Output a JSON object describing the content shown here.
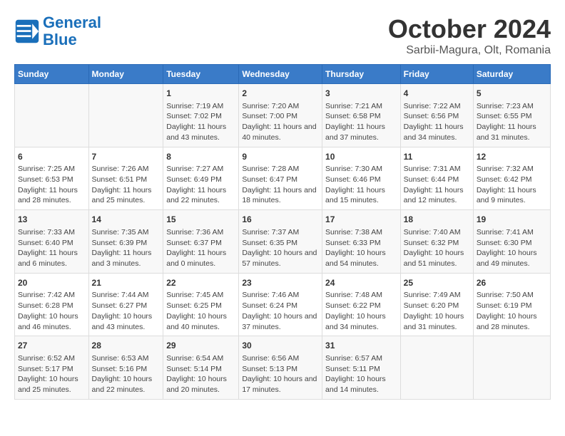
{
  "header": {
    "logo_line1": "General",
    "logo_line2": "Blue",
    "month": "October 2024",
    "location": "Sarbii-Magura, Olt, Romania"
  },
  "days_of_week": [
    "Sunday",
    "Monday",
    "Tuesday",
    "Wednesday",
    "Thursday",
    "Friday",
    "Saturday"
  ],
  "weeks": [
    [
      {
        "day": "",
        "content": ""
      },
      {
        "day": "",
        "content": ""
      },
      {
        "day": "1",
        "content": "Sunrise: 7:19 AM\nSunset: 7:02 PM\nDaylight: 11 hours and 43 minutes."
      },
      {
        "day": "2",
        "content": "Sunrise: 7:20 AM\nSunset: 7:00 PM\nDaylight: 11 hours and 40 minutes."
      },
      {
        "day": "3",
        "content": "Sunrise: 7:21 AM\nSunset: 6:58 PM\nDaylight: 11 hours and 37 minutes."
      },
      {
        "day": "4",
        "content": "Sunrise: 7:22 AM\nSunset: 6:56 PM\nDaylight: 11 hours and 34 minutes."
      },
      {
        "day": "5",
        "content": "Sunrise: 7:23 AM\nSunset: 6:55 PM\nDaylight: 11 hours and 31 minutes."
      }
    ],
    [
      {
        "day": "6",
        "content": "Sunrise: 7:25 AM\nSunset: 6:53 PM\nDaylight: 11 hours and 28 minutes."
      },
      {
        "day": "7",
        "content": "Sunrise: 7:26 AM\nSunset: 6:51 PM\nDaylight: 11 hours and 25 minutes."
      },
      {
        "day": "8",
        "content": "Sunrise: 7:27 AM\nSunset: 6:49 PM\nDaylight: 11 hours and 22 minutes."
      },
      {
        "day": "9",
        "content": "Sunrise: 7:28 AM\nSunset: 6:47 PM\nDaylight: 11 hours and 18 minutes."
      },
      {
        "day": "10",
        "content": "Sunrise: 7:30 AM\nSunset: 6:46 PM\nDaylight: 11 hours and 15 minutes."
      },
      {
        "day": "11",
        "content": "Sunrise: 7:31 AM\nSunset: 6:44 PM\nDaylight: 11 hours and 12 minutes."
      },
      {
        "day": "12",
        "content": "Sunrise: 7:32 AM\nSunset: 6:42 PM\nDaylight: 11 hours and 9 minutes."
      }
    ],
    [
      {
        "day": "13",
        "content": "Sunrise: 7:33 AM\nSunset: 6:40 PM\nDaylight: 11 hours and 6 minutes."
      },
      {
        "day": "14",
        "content": "Sunrise: 7:35 AM\nSunset: 6:39 PM\nDaylight: 11 hours and 3 minutes."
      },
      {
        "day": "15",
        "content": "Sunrise: 7:36 AM\nSunset: 6:37 PM\nDaylight: 11 hours and 0 minutes."
      },
      {
        "day": "16",
        "content": "Sunrise: 7:37 AM\nSunset: 6:35 PM\nDaylight: 10 hours and 57 minutes."
      },
      {
        "day": "17",
        "content": "Sunrise: 7:38 AM\nSunset: 6:33 PM\nDaylight: 10 hours and 54 minutes."
      },
      {
        "day": "18",
        "content": "Sunrise: 7:40 AM\nSunset: 6:32 PM\nDaylight: 10 hours and 51 minutes."
      },
      {
        "day": "19",
        "content": "Sunrise: 7:41 AM\nSunset: 6:30 PM\nDaylight: 10 hours and 49 minutes."
      }
    ],
    [
      {
        "day": "20",
        "content": "Sunrise: 7:42 AM\nSunset: 6:28 PM\nDaylight: 10 hours and 46 minutes."
      },
      {
        "day": "21",
        "content": "Sunrise: 7:44 AM\nSunset: 6:27 PM\nDaylight: 10 hours and 43 minutes."
      },
      {
        "day": "22",
        "content": "Sunrise: 7:45 AM\nSunset: 6:25 PM\nDaylight: 10 hours and 40 minutes."
      },
      {
        "day": "23",
        "content": "Sunrise: 7:46 AM\nSunset: 6:24 PM\nDaylight: 10 hours and 37 minutes."
      },
      {
        "day": "24",
        "content": "Sunrise: 7:48 AM\nSunset: 6:22 PM\nDaylight: 10 hours and 34 minutes."
      },
      {
        "day": "25",
        "content": "Sunrise: 7:49 AM\nSunset: 6:20 PM\nDaylight: 10 hours and 31 minutes."
      },
      {
        "day": "26",
        "content": "Sunrise: 7:50 AM\nSunset: 6:19 PM\nDaylight: 10 hours and 28 minutes."
      }
    ],
    [
      {
        "day": "27",
        "content": "Sunrise: 6:52 AM\nSunset: 5:17 PM\nDaylight: 10 hours and 25 minutes."
      },
      {
        "day": "28",
        "content": "Sunrise: 6:53 AM\nSunset: 5:16 PM\nDaylight: 10 hours and 22 minutes."
      },
      {
        "day": "29",
        "content": "Sunrise: 6:54 AM\nSunset: 5:14 PM\nDaylight: 10 hours and 20 minutes."
      },
      {
        "day": "30",
        "content": "Sunrise: 6:56 AM\nSunset: 5:13 PM\nDaylight: 10 hours and 17 minutes."
      },
      {
        "day": "31",
        "content": "Sunrise: 6:57 AM\nSunset: 5:11 PM\nDaylight: 10 hours and 14 minutes."
      },
      {
        "day": "",
        "content": ""
      },
      {
        "day": "",
        "content": ""
      }
    ]
  ]
}
